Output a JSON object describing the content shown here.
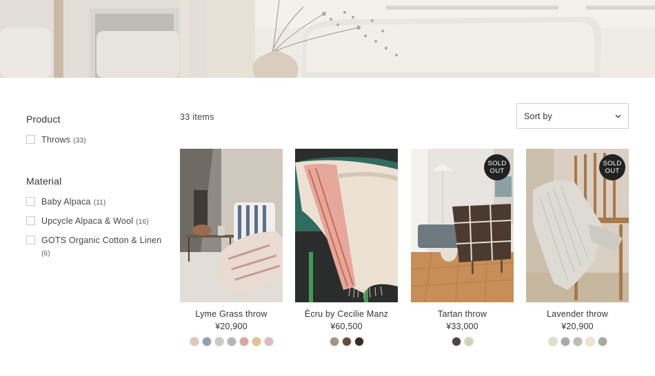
{
  "filters": {
    "product": {
      "title": "Product",
      "options": [
        {
          "label": "Throws",
          "count": "(33)"
        }
      ]
    },
    "material": {
      "title": "Material",
      "options": [
        {
          "label": "Baby Alpaca",
          "count": "(11)"
        },
        {
          "label": "Upcycle Alpaca & Wool",
          "count": "(16)"
        },
        {
          "label": "GOTS Organic Cotton & Linen",
          "count": "(6)"
        }
      ]
    }
  },
  "toolbar": {
    "item_count": "33 items",
    "sort_label": "Sort by",
    "sort_icon": "chevron-down-icon"
  },
  "products": [
    {
      "name": "Lyme Grass throw",
      "price": "¥20,900",
      "sold_out": "",
      "swatches": [
        "#dcc9b6",
        "#8f9fb5",
        "#c9cbc0",
        "#b0b8b2",
        "#d7a7a2",
        "#e0c48a",
        "#e2b9bc"
      ]
    },
    {
      "name": "Ècru by Cecilie Manz",
      "price": "¥60,500",
      "sold_out": "",
      "swatches": [
        "#a39385",
        "#6b4a3a",
        "#3a2c22"
      ]
    },
    {
      "name": "Tartan throw",
      "price": "¥33,000",
      "sold_out": "SOLD OUT",
      "swatches": [
        "#4d4540",
        "#d9d0bc"
      ]
    },
    {
      "name": "Lavender throw",
      "price": "¥20,900",
      "sold_out": "SOLD OUT",
      "swatches": [
        "#e5dcc7",
        "#a9a9a2",
        "#b9bdb2",
        "#efe3cb",
        "#a6aa9c"
      ]
    }
  ]
}
